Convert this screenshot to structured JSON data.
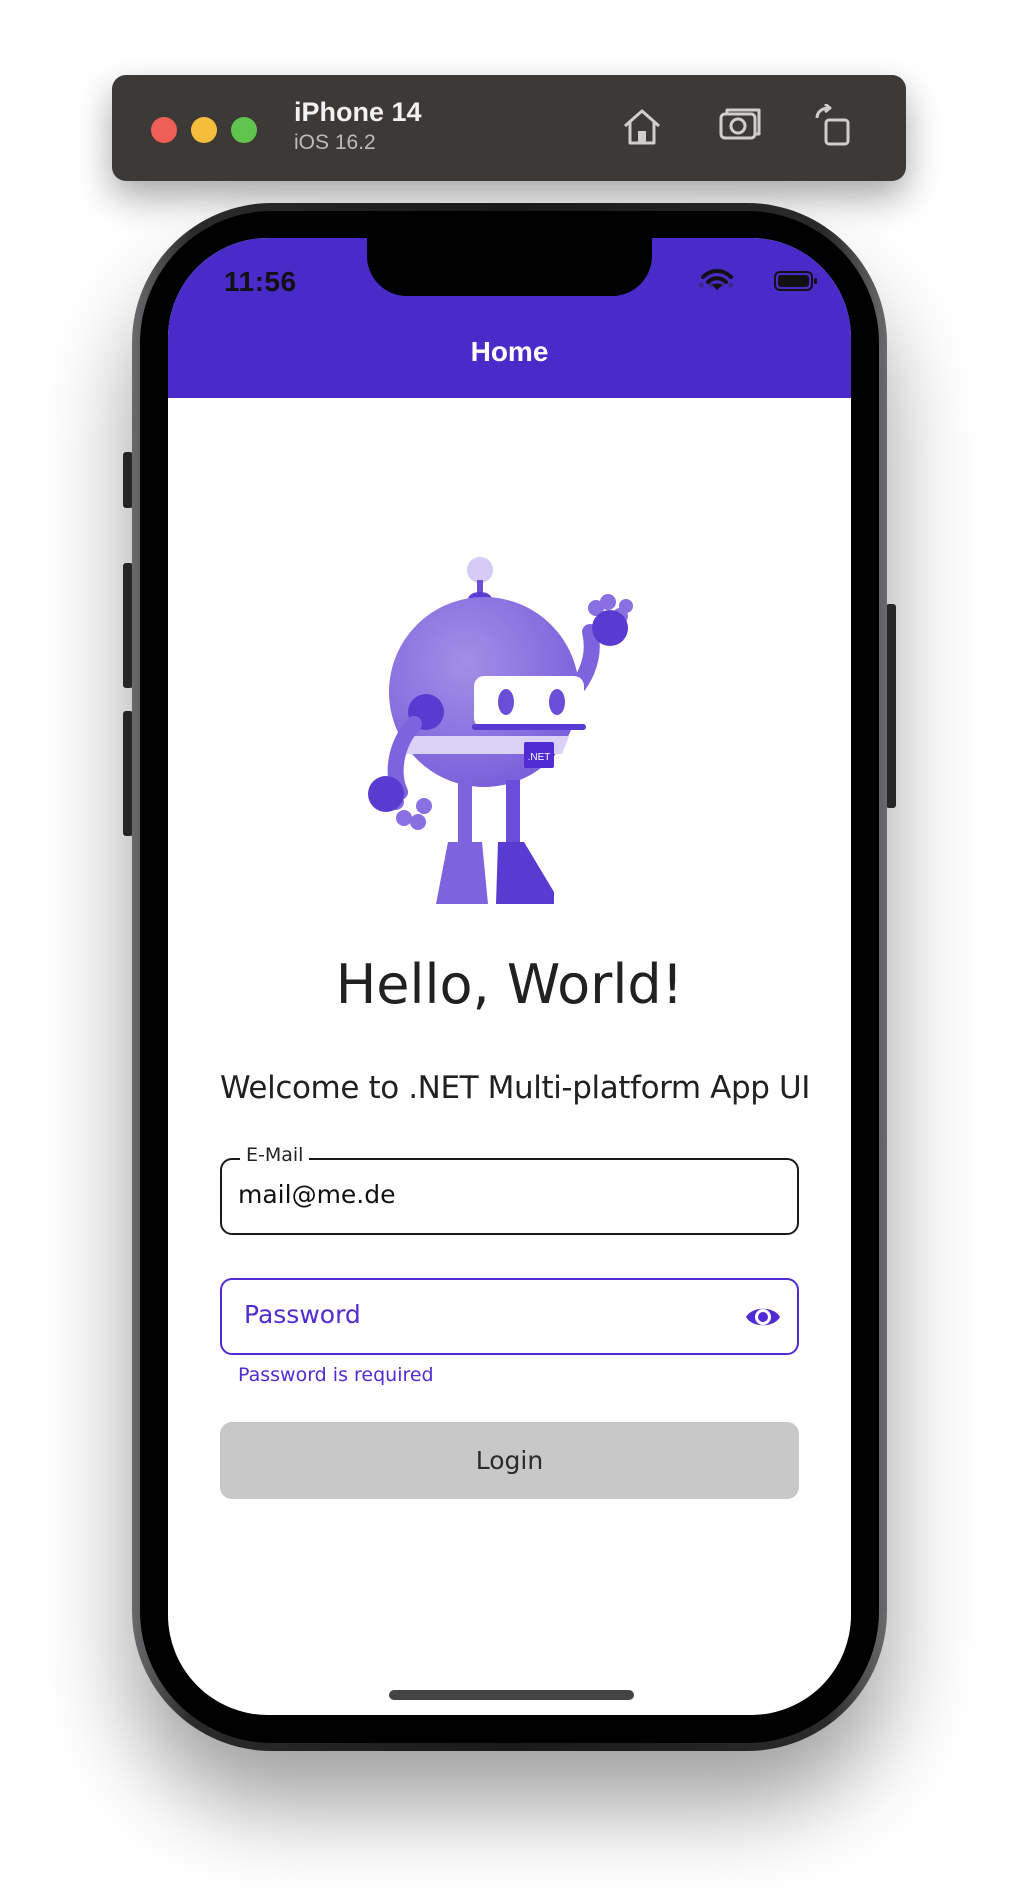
{
  "simulator": {
    "device_name": "iPhone 14",
    "os_version": "iOS 16.2",
    "toolbar_icons": [
      "home-icon",
      "screenshot-icon",
      "rotate-icon"
    ]
  },
  "status_bar": {
    "time": "11:56",
    "icons": [
      "signal-dots-icon",
      "wifi-icon",
      "battery-icon"
    ]
  },
  "nav": {
    "title": "Home"
  },
  "mascot": {
    "badge_text": ".NET"
  },
  "content": {
    "heading": "Hello, World!",
    "subheading": "Welcome to .NET Multi-platform App UI"
  },
  "email": {
    "label": "E-Mail",
    "value": "mail@me.de"
  },
  "password": {
    "placeholder": "Password",
    "helper": "Password is required"
  },
  "login": {
    "label": "Login"
  },
  "colors": {
    "brand": "#512bd4",
    "nav_background": "#4a2bc9",
    "button_disabled": "#c8c8c8"
  }
}
